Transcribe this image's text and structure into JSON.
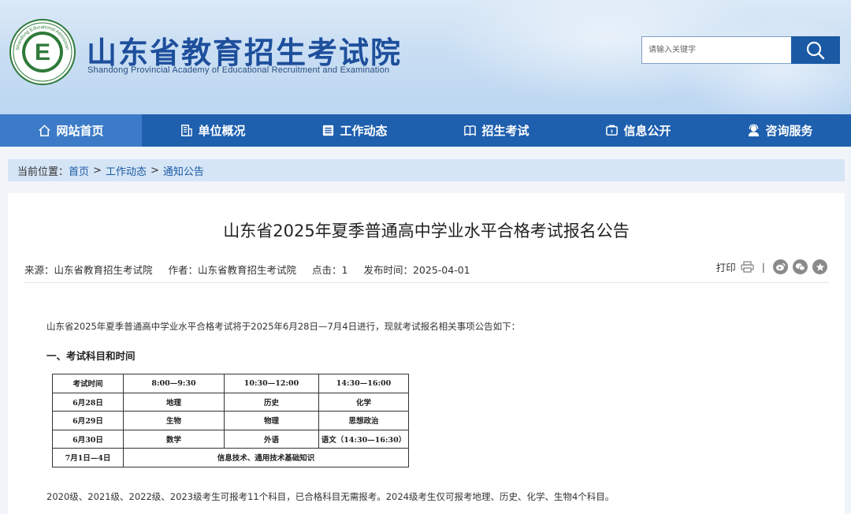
{
  "header": {
    "logo_text": "Shandong Educational Admission & Examination",
    "logo_letter": "E",
    "title": "山东省教育招生考试院",
    "subtitle": "Shandong Provincial Academy of Educational Recruitment and Examination"
  },
  "search": {
    "placeholder": "请输入关键字",
    "icon": "search-icon"
  },
  "nav": {
    "items": [
      {
        "label": "网站首页",
        "icon": "home-icon"
      },
      {
        "label": "单位概况",
        "icon": "building-icon"
      },
      {
        "label": "工作动态",
        "icon": "list-icon"
      },
      {
        "label": "招生考试",
        "icon": "book-icon"
      },
      {
        "label": "信息公开",
        "icon": "info-icon"
      },
      {
        "label": "咨询服务",
        "icon": "service-icon"
      }
    ]
  },
  "breadcrumb": {
    "prefix": "当前位置：",
    "items": [
      "首页",
      "工作动态",
      "通知公告"
    ],
    "separator": ">"
  },
  "article": {
    "title": "山东省2025年夏季普通高中学业水平合格考试报名公告",
    "source": "来源：山东省教育招生考试院",
    "author": "作者：山东省教育招生考试院",
    "clicks": "点击：1",
    "published": "发布时间：2025-04-01",
    "print_label": "打印",
    "share_bar": "|",
    "intro": "山东省2025年夏季普通高中学业水平合格考试将于2025年6月28日—7月4日进行，现就考试报名相关事项公告如下：",
    "section1": "一、考试科目和时间",
    "note": "2020级、2021级、2022级、2023级考生可报考11个科目，已合格科目无需报考。2024级考生仅可报考地理、历史、化学、生物4个科目。"
  },
  "schedule": {
    "header": [
      "考试时间",
      "8:00—9:30",
      "10:30—12:00",
      "14:30—16:00"
    ],
    "rows": [
      [
        "6月28日",
        "地理",
        "历史",
        "化学"
      ],
      [
        "6月29日",
        "生物",
        "物理",
        "思想政治"
      ],
      [
        "6月30日",
        "数学",
        "外语",
        "语文（14:30—16:30）"
      ]
    ],
    "last_row": [
      "7月1日—4日",
      "信息技术、通用技术基础知识"
    ]
  },
  "colors": {
    "nav_bg": "#1e5fae",
    "nav_active": "#3c7bc7",
    "title_blue": "#1e4f9c",
    "crumb_bg": "#d6e5f6"
  }
}
